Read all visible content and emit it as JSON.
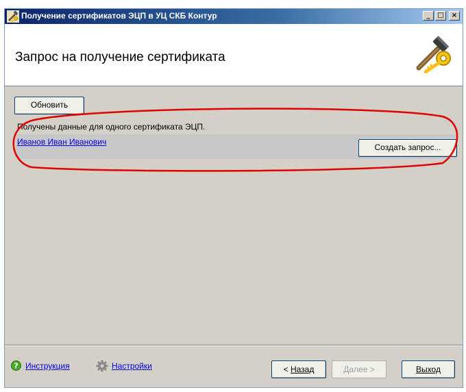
{
  "window": {
    "title": "Получение сертификатов ЭЦП в УЦ СКБ Контур",
    "minimize_glyph": "_",
    "maximize_glyph": "□",
    "close_glyph": "×"
  },
  "header": {
    "heading": "Запрос на получение сертификата",
    "icon": "hammer-key-icon"
  },
  "content": {
    "refresh_label": "Обновить",
    "info_text": "Получены данные для одного сертификата ЭЦП.",
    "certificates": [
      {
        "name": "Иванов Иван Иванович",
        "action_label": "Создать запрос..."
      }
    ]
  },
  "footer": {
    "help_label": "Инструкция",
    "settings_label": "Настройки",
    "back_arrow": "< ",
    "back_label": "Назад",
    "next_label": "Далее",
    "next_arrow": " >",
    "exit_label": "Выход"
  },
  "colors": {
    "highlight": "#e00000",
    "link": "#0000ee",
    "window_bg": "#d4d0c8",
    "titlebar": "#0a246a"
  }
}
